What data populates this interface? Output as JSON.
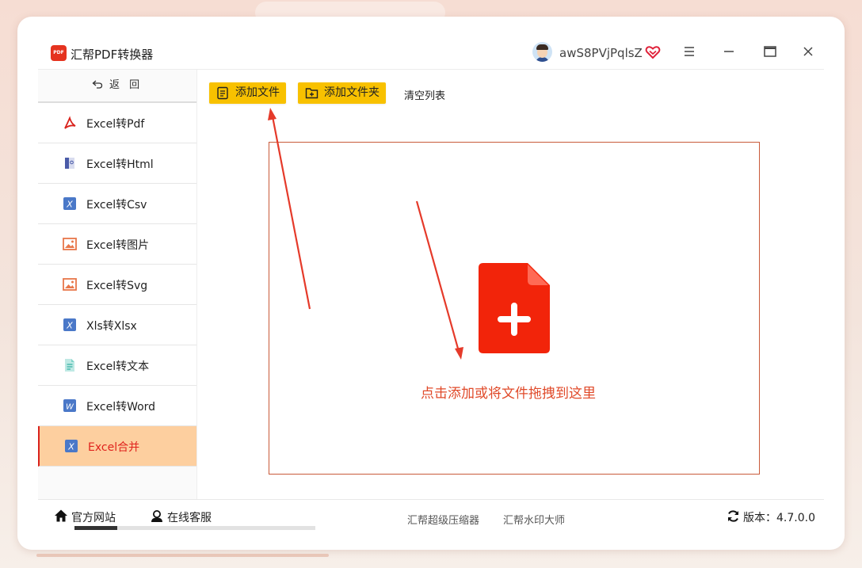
{
  "app": {
    "title": "汇帮PDF转换器",
    "logo_text": "PDF",
    "username": "awS8PVjPqlsZ"
  },
  "sidebar": {
    "back_label": "返",
    "back_label2": "回",
    "items": [
      {
        "label": "Excel转Pdf",
        "icon": "pdf-icon"
      },
      {
        "label": "Excel转Html",
        "icon": "html-book-icon"
      },
      {
        "label": "Excel转Csv",
        "icon": "excel-icon"
      },
      {
        "label": "Excel转图片",
        "icon": "image-icon"
      },
      {
        "label": "Excel转Svg",
        "icon": "image-icon"
      },
      {
        "label": "Xls转Xlsx",
        "icon": "excel-icon"
      },
      {
        "label": "Excel转文本",
        "icon": "text-doc-icon"
      },
      {
        "label": "Excel转Word",
        "icon": "word-icon"
      },
      {
        "label": "Excel合并",
        "icon": "excel-icon",
        "active": true
      }
    ]
  },
  "toolbar": {
    "add_file": "添加文件",
    "add_folder": "添加文件夹",
    "clear_list": "清空列表"
  },
  "dropzone": {
    "hint": "点击添加或将文件拖拽到这里"
  },
  "footer": {
    "official_site": "官方网站",
    "online_service": "在线客服",
    "link1": "汇帮超级压缩器",
    "link2": "汇帮水印大师",
    "version": "版本：4.7.0.0"
  },
  "colors": {
    "accent_yellow": "#f8c100",
    "active_item_bg": "#fdcf9f",
    "brand_red": "#e5331f",
    "hint_red": "#e04a2a"
  }
}
